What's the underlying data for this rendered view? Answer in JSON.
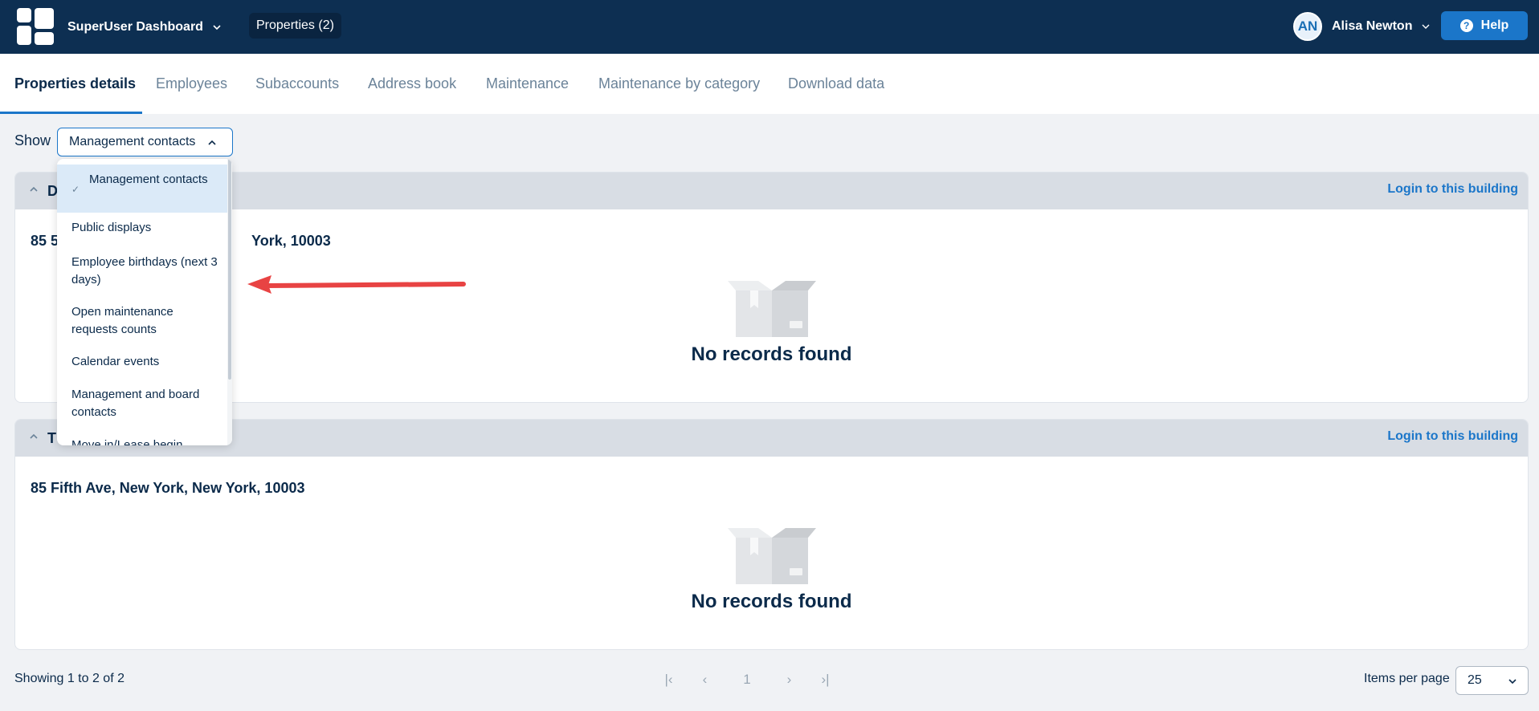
{
  "header": {
    "app_name": "SuperUser Dashboard",
    "properties_pill": "Properties (2)",
    "user": {
      "initials": "AN",
      "name": "Alisa Newton"
    },
    "help_label": "Help"
  },
  "tabs": [
    {
      "label": "Properties details",
      "active": true
    },
    {
      "label": "Employees"
    },
    {
      "label": "Subaccounts"
    },
    {
      "label": "Address book"
    },
    {
      "label": "Maintenance"
    },
    {
      "label": "Maintenance by category"
    },
    {
      "label": "Download data"
    }
  ],
  "filter": {
    "show_label": "Show",
    "selected": "Management contacts",
    "options": [
      "Management contacts",
      "Public displays",
      "Employee birthdays (next 3 days)",
      "Open maintenance requests counts",
      "Calendar events",
      "Management and board contacts",
      "Move in/Lease begin"
    ]
  },
  "buildings": [
    {
      "title_visible": "D",
      "address_visible": "85 5",
      "address_tail_visible": "York, 10003",
      "login_label": "Login to this building",
      "empty_message": "No records found"
    },
    {
      "title_visible": "T",
      "address": "85 Fifth Ave, New York, New York, 10003",
      "login_label": "Login to this building",
      "empty_message": "No records found"
    }
  ],
  "footer": {
    "showing": "Showing 1 to 2 of 2",
    "current_page": "1",
    "items_per_page_label": "Items per page",
    "items_per_page": "25"
  },
  "colors": {
    "topbar": "#0d2f52",
    "accent": "#1b76c9",
    "annotation_arrow": "#e84343"
  }
}
